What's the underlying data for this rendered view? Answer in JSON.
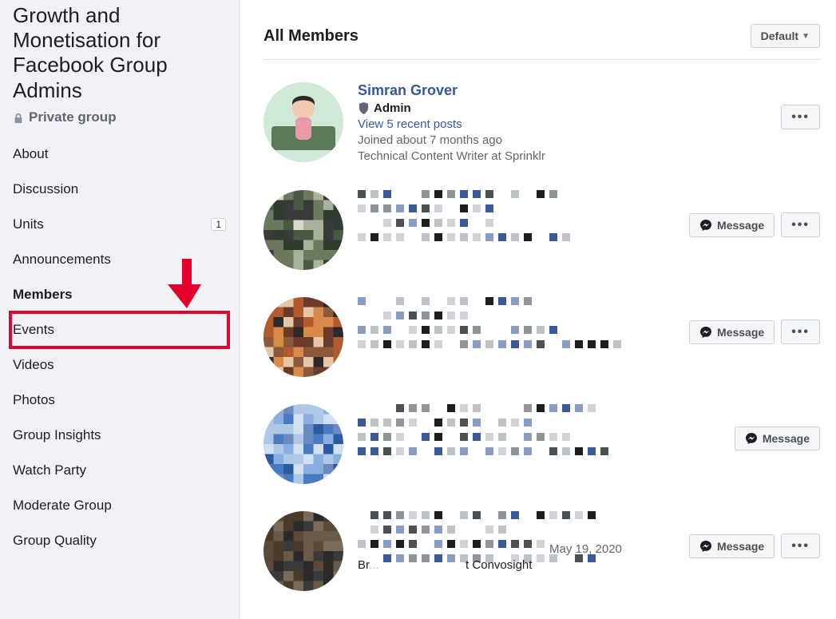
{
  "sidebar": {
    "group_name": "Growth and Monetisation for Facebook Group Admins",
    "privacy_label": "Private group",
    "nav": [
      {
        "label": "About",
        "active": false
      },
      {
        "label": "Discussion",
        "active": false
      },
      {
        "label": "Units",
        "active": false,
        "badge": "1"
      },
      {
        "label": "Announcements",
        "active": false
      },
      {
        "label": "Members",
        "active": true
      },
      {
        "label": "Events",
        "active": false
      },
      {
        "label": "Videos",
        "active": false
      },
      {
        "label": "Photos",
        "active": false
      },
      {
        "label": "Group Insights",
        "active": false
      },
      {
        "label": "Watch Party",
        "active": false
      },
      {
        "label": "Moderate Group",
        "active": false
      },
      {
        "label": "Group Quality",
        "active": false
      }
    ]
  },
  "main": {
    "heading": "All Members",
    "sort_label": "Default",
    "message_button_label": "Message",
    "members": [
      {
        "name": "Simran Grover",
        "admin": true,
        "admin_label": "Admin",
        "recent_posts_label": "View 5 recent posts",
        "joined_label": "Joined about 7 months ago",
        "work_label": "Technical Content Writer at Sprinklr",
        "show_message": false,
        "show_more": true,
        "blurred": false
      },
      {
        "blurred": true,
        "show_message": true,
        "show_more": true
      },
      {
        "blurred": true,
        "show_message": true,
        "show_more": true
      },
      {
        "blurred": true,
        "show_message": true,
        "show_more": false
      },
      {
        "blurred": true,
        "show_message": true,
        "show_more": true,
        "visible_date": "May 19, 2020",
        "visible_suffix": "t Convosight"
      }
    ]
  }
}
